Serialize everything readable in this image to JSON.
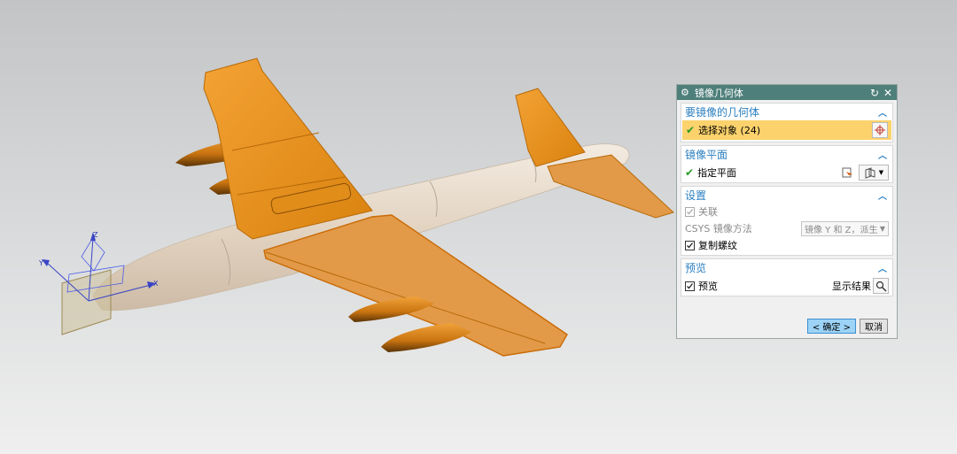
{
  "dialog": {
    "title": "镜像几何体",
    "reset_icon": "reset-icon",
    "close_icon": "close-icon",
    "sections": {
      "geometry": {
        "title": "要镜像的几何体",
        "select_object_label": "选择对象 (24)"
      },
      "plane": {
        "title": "镜像平面",
        "specify_plane_label": "指定平面"
      },
      "settings": {
        "title": "设置",
        "associative_label": "关联",
        "associative_checked": true,
        "csys_label": "CSYS 镜像方法",
        "csys_value": "镜像 Y 和 Z，派生",
        "copy_threads_label": "复制螺纹",
        "copy_threads_checked": true
      },
      "preview": {
        "title": "预览",
        "preview_label": "预览",
        "preview_checked": true,
        "show_result_label": "显示结果"
      }
    },
    "ok_label": "< 确定 >",
    "cancel_label": "取消"
  },
  "viewport": {
    "axis_x": "X",
    "axis_y": "Y",
    "axis_z": "Z",
    "highlight_color": "#e8901a",
    "body_color": "#e6d8c6"
  }
}
